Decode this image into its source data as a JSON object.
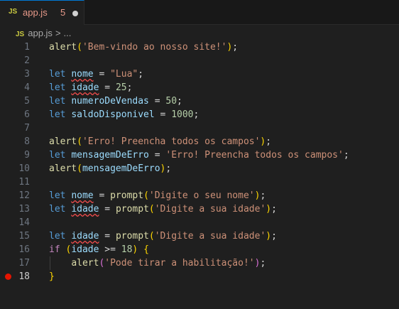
{
  "tab": {
    "icon": "JS",
    "label": "app.js",
    "problems": "5"
  },
  "breadcrumb": {
    "icon": "JS",
    "file": "app.js",
    "separator": ">",
    "rest": "..."
  },
  "editor": {
    "active_line": 18,
    "breakpoint_line": 18,
    "lines": [
      {
        "n": "1",
        "tokens": [
          [
            "fn",
            "alert"
          ],
          [
            "br1",
            "("
          ],
          [
            "str",
            "'Bem-vindo ao nosso site!'"
          ],
          [
            "br1",
            ")"
          ],
          [
            "op",
            ";"
          ]
        ]
      },
      {
        "n": "2",
        "tokens": []
      },
      {
        "n": "3",
        "tokens": [
          [
            "kw",
            "let"
          ],
          [
            "op",
            " "
          ],
          [
            "var squig",
            "nome"
          ],
          [
            "op",
            " = "
          ],
          [
            "str",
            "\"Lua\""
          ],
          [
            "op",
            ";"
          ]
        ]
      },
      {
        "n": "4",
        "tokens": [
          [
            "kw",
            "let"
          ],
          [
            "op",
            " "
          ],
          [
            "var squig",
            "idade"
          ],
          [
            "op",
            " = "
          ],
          [
            "num",
            "25"
          ],
          [
            "op",
            ";"
          ]
        ]
      },
      {
        "n": "5",
        "tokens": [
          [
            "kw",
            "let"
          ],
          [
            "op",
            " "
          ],
          [
            "var",
            "numeroDeVendas"
          ],
          [
            "op",
            " = "
          ],
          [
            "num",
            "50"
          ],
          [
            "op",
            ";"
          ]
        ]
      },
      {
        "n": "6",
        "tokens": [
          [
            "kw",
            "let"
          ],
          [
            "op",
            " "
          ],
          [
            "var",
            "saldoDisponivel"
          ],
          [
            "op",
            " = "
          ],
          [
            "num",
            "1000"
          ],
          [
            "op",
            ";"
          ]
        ]
      },
      {
        "n": "7",
        "tokens": []
      },
      {
        "n": "8",
        "tokens": [
          [
            "fn",
            "alert"
          ],
          [
            "br1",
            "("
          ],
          [
            "str",
            "'Erro! Preencha todos os campos'"
          ],
          [
            "br1",
            ")"
          ],
          [
            "op",
            ";"
          ]
        ]
      },
      {
        "n": "9",
        "tokens": [
          [
            "kw",
            "let"
          ],
          [
            "op",
            " "
          ],
          [
            "var",
            "mensagemDeErro"
          ],
          [
            "op",
            " = "
          ],
          [
            "str",
            "'Erro! Preencha todos os campos'"
          ],
          [
            "op",
            ";"
          ]
        ]
      },
      {
        "n": "10",
        "tokens": [
          [
            "fn",
            "alert"
          ],
          [
            "br1",
            "("
          ],
          [
            "var",
            "mensagemDeErro"
          ],
          [
            "br1",
            ")"
          ],
          [
            "op",
            ";"
          ]
        ]
      },
      {
        "n": "11",
        "tokens": []
      },
      {
        "n": "12",
        "tokens": [
          [
            "kw",
            "let"
          ],
          [
            "op",
            " "
          ],
          [
            "var squig",
            "nome"
          ],
          [
            "op",
            " = "
          ],
          [
            "fn",
            "prompt"
          ],
          [
            "br1",
            "("
          ],
          [
            "str",
            "'Digite o seu nome'"
          ],
          [
            "br1",
            ")"
          ],
          [
            "op",
            ";"
          ]
        ]
      },
      {
        "n": "13",
        "tokens": [
          [
            "kw",
            "let"
          ],
          [
            "op",
            " "
          ],
          [
            "var squig",
            "idade"
          ],
          [
            "op",
            " = "
          ],
          [
            "fn",
            "prompt"
          ],
          [
            "br1",
            "("
          ],
          [
            "str",
            "'Digite a sua idade'"
          ],
          [
            "br1",
            ")"
          ],
          [
            "op",
            ";"
          ]
        ]
      },
      {
        "n": "14",
        "tokens": []
      },
      {
        "n": "15",
        "tokens": [
          [
            "kw",
            "let"
          ],
          [
            "op",
            " "
          ],
          [
            "var squig",
            "idade"
          ],
          [
            "op",
            " = "
          ],
          [
            "fn",
            "prompt"
          ],
          [
            "br1",
            "("
          ],
          [
            "str",
            "'Digite a sua idade'"
          ],
          [
            "br1",
            ")"
          ],
          [
            "op",
            ";"
          ]
        ]
      },
      {
        "n": "16",
        "tokens": [
          [
            "ctl",
            "if"
          ],
          [
            "op",
            " "
          ],
          [
            "br1",
            "("
          ],
          [
            "var",
            "idade"
          ],
          [
            "op",
            " >= "
          ],
          [
            "num",
            "18"
          ],
          [
            "br1",
            ")"
          ],
          [
            "op",
            " "
          ],
          [
            "br1",
            "{"
          ]
        ]
      },
      {
        "n": "17",
        "tokens": [
          [
            "op",
            "    "
          ],
          [
            "fn",
            "alert"
          ],
          [
            "br2",
            "("
          ],
          [
            "str",
            "'Pode tirar a habilitação!'"
          ],
          [
            "br2",
            ")"
          ],
          [
            "op",
            ";"
          ]
        ]
      },
      {
        "n": "18",
        "tokens": [
          [
            "br1",
            "}"
          ]
        ]
      }
    ]
  },
  "colors": {
    "background": "#1f1f1f",
    "tab_accent": "#0078d4",
    "error": "#f14c4c",
    "breakpoint": "#e51400"
  }
}
